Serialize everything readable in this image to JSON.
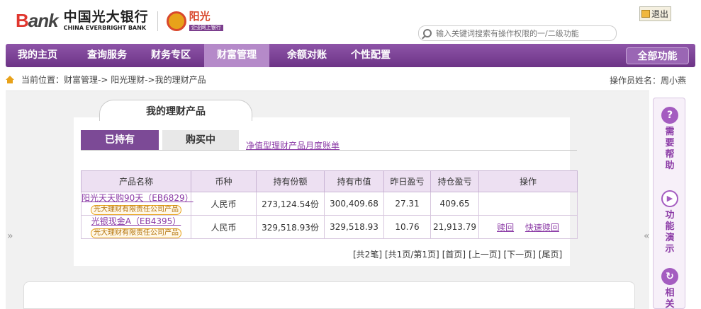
{
  "header": {
    "logo_bank": "Bank",
    "logo_cn": "中国光大银行",
    "logo_en": "CHINA EVERBRIGHT BANK",
    "sun_title": "阳光",
    "sun_sub": "企业网上银行",
    "logout": "退出",
    "search_placeholder": "输入关键词搜索有操作权限的一/二级功能"
  },
  "nav": {
    "items": [
      {
        "label": "我的主页"
      },
      {
        "label": "查询服务"
      },
      {
        "label": "财务专区"
      },
      {
        "label": "财富管理"
      },
      {
        "label": "余额对账"
      },
      {
        "label": "个性配置"
      }
    ],
    "active": "财富管理",
    "all_functions": "全部功能"
  },
  "breadcrumb": {
    "text": "当前位置：财富管理->  阳光理财->我的理财产品",
    "operator": "操作员姓名：周小燕"
  },
  "page": {
    "main_tab": "我的理财产品",
    "tab_held": "已持有",
    "tab_buying": "购买中",
    "bill_link": "净值型理财产品月度账单"
  },
  "table": {
    "headers": [
      "产品名称",
      "币种",
      "持有份额",
      "持有市值",
      "昨日盈亏",
      "持仓盈亏",
      "操作"
    ],
    "rows": [
      {
        "name": "阳光天天购90天（EB6829）",
        "issuer": "光大理财有限责任公司产品",
        "currency": "人民币",
        "shares": "273,124.54份",
        "value": "300,409.68",
        "yesterday": "27.31",
        "position": "409.65",
        "actions": []
      },
      {
        "name": "光银现金A（EB4395）",
        "issuer": "光大理财有限责任公司产品",
        "currency": "人民币",
        "shares": "329,518.93份",
        "value": "329,518.93",
        "yesterday": "10.76",
        "position": "21,913.79",
        "actions": [
          "赎回",
          "快速赎回"
        ]
      }
    ]
  },
  "pager": {
    "total": "[共2笔]",
    "pages": "[共1页/第1页]",
    "first": "[首页]",
    "prev": "[上一页]",
    "next": "[下一页]",
    "last": "[尾页]"
  },
  "side": {
    "help": "需要帮助",
    "demo": "功能演示",
    "related": "相关"
  },
  "arrows": {
    "left": "»",
    "right": "«"
  },
  "icons": {
    "help": "question-icon",
    "demo": "play-icon",
    "related": "refresh-icon"
  }
}
